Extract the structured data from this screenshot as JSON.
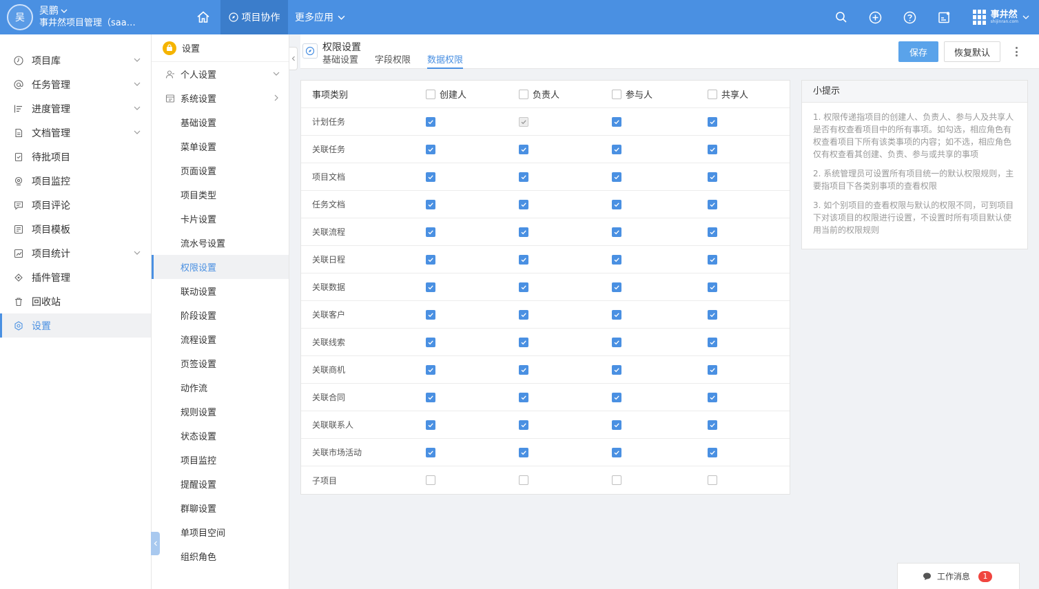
{
  "user": {
    "avatar_letter": "吴",
    "name": "吴鹏",
    "org": "事井然项目管理（saas..."
  },
  "topnav": {
    "active_tab": "项目协作",
    "more_tab": "更多应用"
  },
  "brand": {
    "name": "事井然",
    "sub": "shijinran.com"
  },
  "sidebar": {
    "items": [
      {
        "label": "项目库",
        "icon": "clock-icon",
        "has_chevron": true
      },
      {
        "label": "任务管理",
        "icon": "at-icon",
        "has_chevron": true
      },
      {
        "label": "进度管理",
        "icon": "progress-icon",
        "has_chevron": true
      },
      {
        "label": "文档管理",
        "icon": "doc-icon",
        "has_chevron": true
      },
      {
        "label": "待批项目",
        "icon": "approve-icon",
        "has_chevron": false
      },
      {
        "label": "项目监控",
        "icon": "monitor-icon",
        "has_chevron": false
      },
      {
        "label": "项目评论",
        "icon": "comment-icon",
        "has_chevron": false
      },
      {
        "label": "项目模板",
        "icon": "template-icon",
        "has_chevron": false
      },
      {
        "label": "项目统计",
        "icon": "stats-icon",
        "has_chevron": true
      },
      {
        "label": "插件管理",
        "icon": "plugin-icon",
        "has_chevron": false
      },
      {
        "label": "回收站",
        "icon": "trash-icon",
        "has_chevron": false
      },
      {
        "label": "设置",
        "icon": "settings-icon",
        "has_chevron": false,
        "active": true
      }
    ]
  },
  "settings_nav": {
    "title": "设置",
    "groups": [
      {
        "label": "个人设置",
        "chevron": "down"
      },
      {
        "label": "系统设置",
        "chevron": "right"
      }
    ],
    "items": [
      "基础设置",
      "菜单设置",
      "页面设置",
      "项目类型",
      "卡片设置",
      "流水号设置",
      "权限设置",
      "联动设置",
      "阶段设置",
      "流程设置",
      "页签设置",
      "动作流",
      "规则设置",
      "状态设置",
      "项目监控",
      "提醒设置",
      "群聊设置",
      "单项目空间",
      "组织角色"
    ],
    "active_item": "权限设置"
  },
  "content": {
    "title": "权限设置",
    "tabs": [
      "基础设置",
      "字段权限",
      "数据权限"
    ],
    "active_tab": "数据权限",
    "save_label": "保存",
    "reset_label": "恢复默认"
  },
  "table": {
    "header": {
      "category": "事项类别",
      "columns": [
        "创建人",
        "负责人",
        "参与人",
        "共享人"
      ]
    },
    "rows": [
      {
        "name": "计划任务",
        "states": [
          "on",
          "dis",
          "on",
          "on"
        ]
      },
      {
        "name": "关联任务",
        "states": [
          "on",
          "on",
          "on",
          "on"
        ]
      },
      {
        "name": "项目文档",
        "states": [
          "on",
          "on",
          "on",
          "on"
        ]
      },
      {
        "name": "任务文档",
        "states": [
          "on",
          "on",
          "on",
          "on"
        ]
      },
      {
        "name": "关联流程",
        "states": [
          "on",
          "on",
          "on",
          "on"
        ]
      },
      {
        "name": "关联日程",
        "states": [
          "on",
          "on",
          "on",
          "on"
        ]
      },
      {
        "name": "关联数据",
        "states": [
          "on",
          "on",
          "on",
          "on"
        ]
      },
      {
        "name": "关联客户",
        "states": [
          "on",
          "on",
          "on",
          "on"
        ]
      },
      {
        "name": "关联线索",
        "states": [
          "on",
          "on",
          "on",
          "on"
        ]
      },
      {
        "name": "关联商机",
        "states": [
          "on",
          "on",
          "on",
          "on"
        ]
      },
      {
        "name": "关联合同",
        "states": [
          "on",
          "on",
          "on",
          "on"
        ]
      },
      {
        "name": "关联联系人",
        "states": [
          "on",
          "on",
          "on",
          "on"
        ]
      },
      {
        "name": "关联市场活动",
        "states": [
          "on",
          "on",
          "on",
          "on"
        ]
      },
      {
        "name": "子项目",
        "states": [
          "off",
          "off",
          "off",
          "off"
        ]
      }
    ]
  },
  "tip": {
    "title": "小提示",
    "paragraphs": [
      "1. 权限传递指项目的创建人、负责人、参与人及共享人是否有权查看项目中的所有事项。如勾选，相应角色有权查看项目下所有该类事项的内容；如不选，相应角色仅有权查看其创建、负责、参与或共享的事项",
      "2. 系统管理员可设置所有项目统一的默认权限规则，主要指项目下各类别事项的查看权限",
      "3. 如个别项目的查看权限与默认的权限不同，可到项目下对该项目的权限进行设置，不设置时所有项目默认使用当前的权限规则"
    ]
  },
  "work_msg": {
    "label": "工作消息",
    "count": "1"
  },
  "colors": {
    "primary": "#4a90e2",
    "topbar": "#4a90e2",
    "badge": "#f0453f"
  }
}
